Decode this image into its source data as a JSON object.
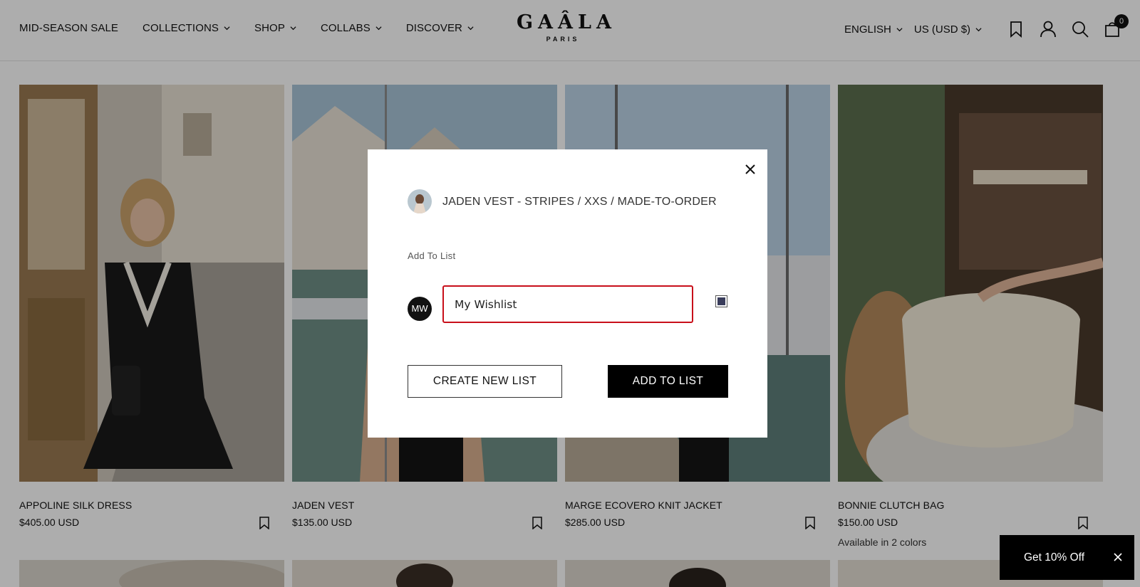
{
  "header": {
    "nav": [
      {
        "label": "MID-SEASON SALE",
        "dropdown": false
      },
      {
        "label": "COLLECTIONS",
        "dropdown": true
      },
      {
        "label": "SHOP",
        "dropdown": true
      },
      {
        "label": "COLLABS",
        "dropdown": true
      },
      {
        "label": "DISCOVER",
        "dropdown": true
      }
    ],
    "logo": {
      "main": "GAÂLA",
      "sub": "PARIS"
    },
    "language": "ENGLISH",
    "currency": "US (USD $)",
    "cart_count": "0"
  },
  "products": [
    {
      "title": "APPOLINE SILK DRESS",
      "price": "$405.00 USD",
      "note": ""
    },
    {
      "title": "JADEN VEST",
      "price": "$135.00 USD",
      "note": ""
    },
    {
      "title": "MARGE ECOVERO KNIT JACKET",
      "price": "$285.00 USD",
      "note": ""
    },
    {
      "title": "BONNIE CLUTCH BAG",
      "price": "$150.00 USD",
      "note": "Available in 2 colors"
    }
  ],
  "modal": {
    "product_title": "JADEN VEST - STRIPES / XXS / MADE-TO-ORDER",
    "section_label": "Add To List",
    "avatar_initials": "MW",
    "list_name_value": "My Wishlist",
    "list_checked": true,
    "create_button": "CREATE NEW LIST",
    "add_button": "ADD TO LIST"
  },
  "promo": {
    "label": "Get 10% Off"
  },
  "colors": {
    "accent_error": "#c80f1a",
    "checkbox_fill": "#3a3d5c",
    "overlay": "rgba(0,0,0,0.32)"
  }
}
